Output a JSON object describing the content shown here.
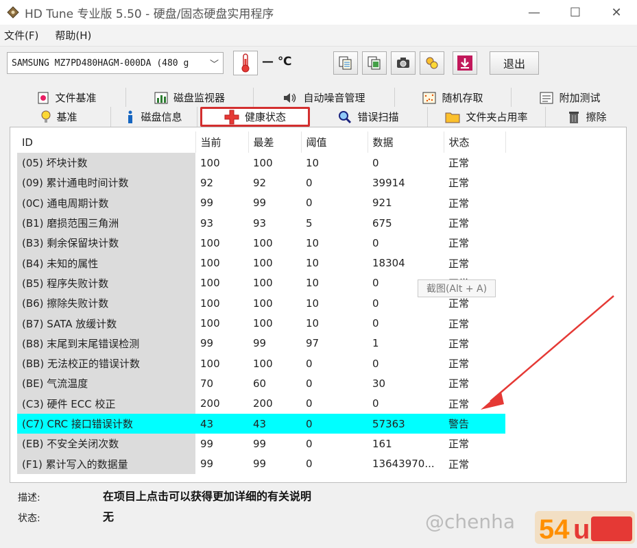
{
  "window": {
    "title": "HD Tune 专业版 5.50 - 硬盘/固态硬盘实用程序",
    "minimize": "—",
    "maximize": "☐",
    "close": "✕"
  },
  "menu": [
    "文件(F)",
    "帮助(H)"
  ],
  "toolbar": {
    "drive": "SAMSUNG MZ7PD480HAGM-000DA (480 g",
    "temperature": "— ℃",
    "exit_label": "退出"
  },
  "tabs_top": [
    {
      "label": "文件基准",
      "icon": "file-benchmark-icon"
    },
    {
      "label": "磁盘监视器",
      "icon": "disk-monitor-icon"
    },
    {
      "label": "自动噪音管理",
      "icon": "speaker-icon"
    },
    {
      "label": "随机存取",
      "icon": "random-access-icon"
    },
    {
      "label": "附加测试",
      "icon": "extra-tests-icon"
    }
  ],
  "tabs_bottom": [
    {
      "label": "基准",
      "icon": "benchmark-icon"
    },
    {
      "label": "磁盘信息",
      "icon": "info-icon"
    },
    {
      "label": "健康状态",
      "icon": "health-cross-icon",
      "active": true
    },
    {
      "label": "错误扫描",
      "icon": "magnifier-icon"
    },
    {
      "label": "文件夹占用率",
      "icon": "folder-icon"
    },
    {
      "label": "擦除",
      "icon": "trash-icon"
    }
  ],
  "table": {
    "headers": [
      "ID",
      "当前",
      "最差",
      "阈值",
      "数据",
      "状态"
    ],
    "rows": [
      [
        "(05) 坏块计数",
        "100",
        "100",
        "10",
        "0",
        "正常"
      ],
      [
        "(09) 累计通电时间计数",
        "92",
        "92",
        "0",
        "39914",
        "正常"
      ],
      [
        "(0C) 通电周期计数",
        "99",
        "99",
        "0",
        "921",
        "正常"
      ],
      [
        "(B1) 磨损范围三角洲",
        "93",
        "93",
        "5",
        "675",
        "正常"
      ],
      [
        "(B3) 剩余保留块计数",
        "100",
        "100",
        "10",
        "0",
        "正常"
      ],
      [
        "(B4) 未知的属性",
        "100",
        "100",
        "10",
        "18304",
        "正常"
      ],
      [
        "(B5) 程序失败计数",
        "100",
        "100",
        "10",
        "0",
        "正常"
      ],
      [
        "(B6) 擦除失败计数",
        "100",
        "100",
        "10",
        "0",
        "正常"
      ],
      [
        "(B7) SATA 放缓计数",
        "100",
        "100",
        "10",
        "0",
        "正常"
      ],
      [
        "(B8) 末尾到末尾错误检测",
        "99",
        "99",
        "97",
        "1",
        "正常"
      ],
      [
        "(BB) 无法校正的错误计数",
        "100",
        "100",
        "0",
        "0",
        "正常"
      ],
      [
        "(BE) 气流温度",
        "70",
        "60",
        "0",
        "30",
        "正常"
      ],
      [
        "(C3) 硬件 ECC 校正",
        "200",
        "200",
        "0",
        "0",
        "正常"
      ],
      [
        "(C7) CRC 接口错误计数",
        "43",
        "43",
        "0",
        "57363",
        "警告"
      ],
      [
        "(EB) 不安全关闭次数",
        "99",
        "99",
        "0",
        "161",
        "正常"
      ],
      [
        "(F1) 累计写入的数据量",
        "99",
        "99",
        "0",
        "13643970...",
        "正常"
      ]
    ],
    "warning_row_color": "#00ffff"
  },
  "tooltip": "截图(Alt + A)",
  "description": {
    "desc_label": "描述:",
    "desc_value": "在项目上点击可以获得更加详细的有关说明",
    "status_label": "状态:",
    "status_value": "无"
  },
  "watermark": "@chenha"
}
